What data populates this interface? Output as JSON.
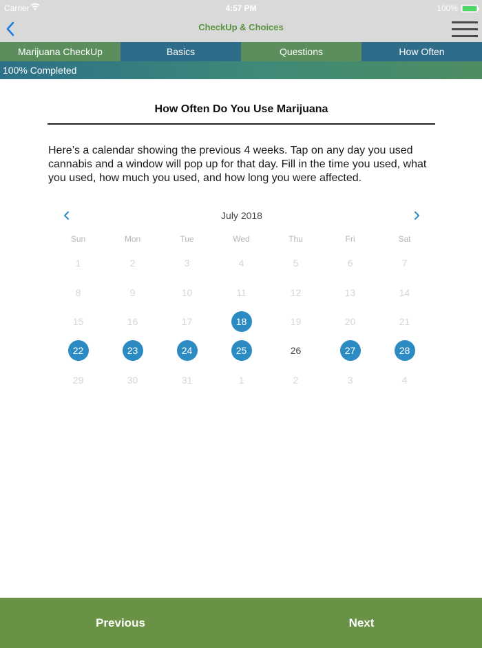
{
  "status_bar": {
    "carrier": "Carrier",
    "time": "4:57 PM",
    "battery": "100%"
  },
  "nav": {
    "logo": "CheckUp & Choices"
  },
  "tabs": [
    {
      "label": "Marijuana CheckUp",
      "color": "#5b8d5d"
    },
    {
      "label": "Basics",
      "color": "#2e6c8a"
    },
    {
      "label": "Questions",
      "color": "#5b8d5d"
    },
    {
      "label": "How Often",
      "color": "#2e6c8a"
    }
  ],
  "progress": {
    "label": "100% Completed",
    "value": 1.0
  },
  "page": {
    "title": "How Often Do You Use Marijuana",
    "intro": "Here’s a calendar showing the previous 4 weeks. Tap on any day you used cannabis and a window will pop up for that day. Fill in the time you used, what you used, how much you used, and how long you were affected."
  },
  "calendar": {
    "month": "July 2018",
    "weekdays": [
      "Sun",
      "Mon",
      "Tue",
      "Wed",
      "Thu",
      "Fri",
      "Sat"
    ],
    "selected_color": "#2c8bc2",
    "days": [
      {
        "label": "1",
        "state": "disabled"
      },
      {
        "label": "2",
        "state": "disabled"
      },
      {
        "label": "3",
        "state": "disabled"
      },
      {
        "label": "4",
        "state": "disabled"
      },
      {
        "label": "5",
        "state": "disabled"
      },
      {
        "label": "6",
        "state": "disabled"
      },
      {
        "label": "7",
        "state": "disabled"
      },
      {
        "label": "8",
        "state": "disabled"
      },
      {
        "label": "9",
        "state": "disabled"
      },
      {
        "label": "10",
        "state": "disabled"
      },
      {
        "label": "11",
        "state": "disabled"
      },
      {
        "label": "12",
        "state": "disabled"
      },
      {
        "label": "13",
        "state": "disabled"
      },
      {
        "label": "14",
        "state": "disabled"
      },
      {
        "label": "15",
        "state": "disabled"
      },
      {
        "label": "16",
        "state": "disabled"
      },
      {
        "label": "17",
        "state": "disabled"
      },
      {
        "label": "18",
        "state": "selected"
      },
      {
        "label": "19",
        "state": "disabled"
      },
      {
        "label": "20",
        "state": "disabled"
      },
      {
        "label": "21",
        "state": "disabled"
      },
      {
        "label": "22",
        "state": "selected"
      },
      {
        "label": "23",
        "state": "selected"
      },
      {
        "label": "24",
        "state": "selected"
      },
      {
        "label": "25",
        "state": "selected"
      },
      {
        "label": "26",
        "state": "today"
      },
      {
        "label": "27",
        "state": "selected"
      },
      {
        "label": "28",
        "state": "selected"
      },
      {
        "label": "29",
        "state": "disabled"
      },
      {
        "label": "30",
        "state": "disabled"
      },
      {
        "label": "31",
        "state": "disabled"
      },
      {
        "label": "1",
        "state": "disabled"
      },
      {
        "label": "2",
        "state": "disabled"
      },
      {
        "label": "3",
        "state": "disabled"
      },
      {
        "label": "4",
        "state": "disabled"
      }
    ]
  },
  "footer": {
    "previous": "Previous",
    "next": "Next"
  }
}
